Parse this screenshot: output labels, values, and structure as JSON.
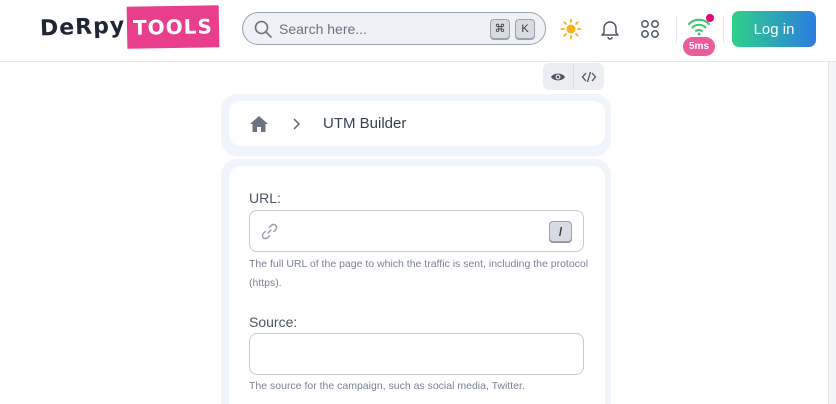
{
  "header": {
    "logo_left": "DeRpy",
    "logo_right": "TOOLS",
    "search_placeholder": "Search here...",
    "shortcut_mod": "⌘",
    "shortcut_key": "K",
    "ping": "5ms",
    "login_label": "Log in"
  },
  "breadcrumb": {
    "current": "UTM Builder"
  },
  "form": {
    "url_label": "URL:",
    "url_value": "",
    "url_shortcut": "/",
    "url_help": "The full URL of the page to which the traffic is sent, including the protocol (https).",
    "source_label": "Source:",
    "source_value": "",
    "source_help": "The source for the campaign, such as social media, Twitter."
  },
  "colors": {
    "brand_pink": "#e83e8c",
    "login_gradient_start": "#2fd08a",
    "login_gradient_end": "#2b7de0",
    "status_dot": "#e6007e"
  },
  "icons": [
    "search-icon",
    "sun-icon",
    "bell-icon",
    "apps-grid-icon",
    "wifi-icon",
    "eye-icon",
    "code-icon",
    "home-icon",
    "chevron-right-icon",
    "link-icon"
  ]
}
